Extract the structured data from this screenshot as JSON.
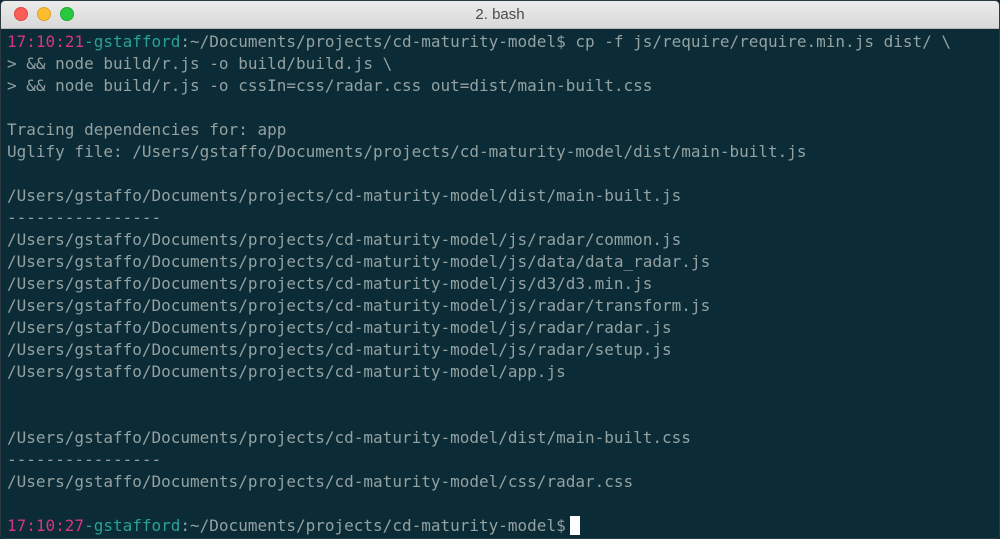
{
  "window": {
    "title": "2. bash"
  },
  "prompt1": {
    "time": "17:10:21",
    "user": "-gstafford",
    "path": ":~/Documents/projects/cd-maturity-model$",
    "command": " cp -f js/require/require.min.js dist/ \\"
  },
  "output_lines": [
    "> && node build/r.js -o build/build.js \\",
    "> && node build/r.js -o cssIn=css/radar.css out=dist/main-built.css",
    "",
    "Tracing dependencies for: app",
    "Uglify file: /Users/gstaffo/Documents/projects/cd-maturity-model/dist/main-built.js",
    "",
    "/Users/gstaffo/Documents/projects/cd-maturity-model/dist/main-built.js",
    "----------------",
    "/Users/gstaffo/Documents/projects/cd-maturity-model/js/radar/common.js",
    "/Users/gstaffo/Documents/projects/cd-maturity-model/js/data/data_radar.js",
    "/Users/gstaffo/Documents/projects/cd-maturity-model/js/d3/d3.min.js",
    "/Users/gstaffo/Documents/projects/cd-maturity-model/js/radar/transform.js",
    "/Users/gstaffo/Documents/projects/cd-maturity-model/js/radar/radar.js",
    "/Users/gstaffo/Documents/projects/cd-maturity-model/js/radar/setup.js",
    "/Users/gstaffo/Documents/projects/cd-maturity-model/app.js",
    "",
    "",
    "/Users/gstaffo/Documents/projects/cd-maturity-model/dist/main-built.css",
    "----------------",
    "/Users/gstaffo/Documents/projects/cd-maturity-model/css/radar.css",
    ""
  ],
  "prompt2": {
    "time": "17:10:27",
    "user": "-gstafford",
    "path": ":~/Documents/projects/cd-maturity-model$"
  },
  "colors": {
    "background": "#0b2b36",
    "text": "#93a1a1",
    "prompt_time": "#d33682",
    "prompt_user": "#2aa198",
    "cursor": "#fdfdfd"
  }
}
